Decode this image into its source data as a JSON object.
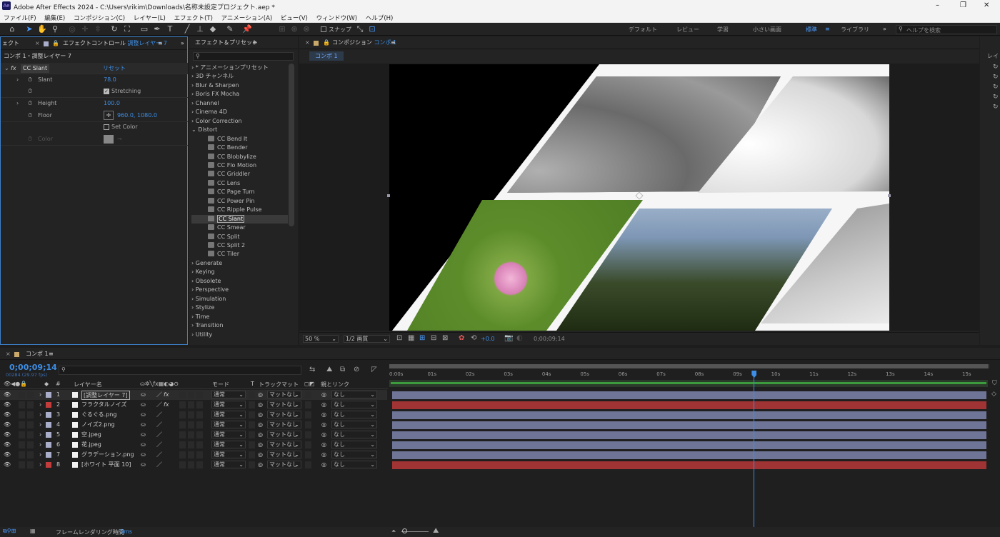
{
  "window": {
    "title": "Adobe After Effects 2024 - C:\\Users\\rikim\\Downloads\\名称未設定プロジェクト.aep *",
    "app_badge": "Ae",
    "controls": [
      "–",
      "❐",
      "✕"
    ]
  },
  "menu": [
    "ファイル(F)",
    "編集(E)",
    "コンポジション(C)",
    "レイヤー(L)",
    "エフェクト(T)",
    "アニメーション(A)",
    "ビュー(V)",
    "ウィンドウ(W)",
    "ヘルプ(H)"
  ],
  "toolbar": {
    "snap_label": "スナップ",
    "workspaces": [
      "デフォルト",
      "レビュー",
      "学習",
      "小さい画面",
      "標準",
      "ライブラリ"
    ],
    "active_workspace": "標準",
    "search_placeholder": "ヘルプを検索",
    "more": "»"
  },
  "effect_controls": {
    "tab_left": "ェクト",
    "tab_prefix": "エフェクトコントロール",
    "tab_layer": "調整レイヤー 7",
    "breadcrumb": "コンポ 1・調整レイヤー 7",
    "effect_name": "CC Slant",
    "reset_label": "リセット",
    "params": [
      {
        "name": "Slant",
        "value": "78.0"
      },
      {
        "name": "",
        "value": "Stretching",
        "type": "checkbox",
        "checked": true
      },
      {
        "name": "Height",
        "value": "100.0"
      },
      {
        "name": "Floor",
        "value": "960.0, 1080.0"
      },
      {
        "name": "",
        "value": "Set Color",
        "type": "checkbox",
        "checked": false
      },
      {
        "name": "Color",
        "value": "",
        "disabled": true
      }
    ]
  },
  "effects_presets": {
    "tab": "エフェクト＆プリセット",
    "search_placeholder": "",
    "items": [
      {
        "label": "* アニメーションプリセット",
        "level": 0
      },
      {
        "label": "3D チャンネル",
        "level": 0
      },
      {
        "label": "Blur & Sharpen",
        "level": 0
      },
      {
        "label": "Boris FX Mocha",
        "level": 0
      },
      {
        "label": "Channel",
        "level": 0
      },
      {
        "label": "Cinema 4D",
        "level": 0
      },
      {
        "label": "Color Correction",
        "level": 0
      },
      {
        "label": "Distort",
        "level": 0,
        "open": true
      },
      {
        "label": "CC Bend It",
        "level": 1
      },
      {
        "label": "CC Bender",
        "level": 1
      },
      {
        "label": "CC Blobbylize",
        "level": 1
      },
      {
        "label": "CC Flo Motion",
        "level": 1
      },
      {
        "label": "CC Griddler",
        "level": 1
      },
      {
        "label": "CC Lens",
        "level": 1
      },
      {
        "label": "CC Page Turn",
        "level": 1
      },
      {
        "label": "CC Power Pin",
        "level": 1
      },
      {
        "label": "CC Ripple Pulse",
        "level": 1
      },
      {
        "label": "CC Slant",
        "level": 1,
        "selected": true
      },
      {
        "label": "CC Smear",
        "level": 1
      },
      {
        "label": "CC Split",
        "level": 1
      },
      {
        "label": "CC Split 2",
        "level": 1
      },
      {
        "label": "CC Tiler",
        "level": 1
      },
      {
        "label": "Generate",
        "level": 0
      },
      {
        "label": "Keying",
        "level": 0
      },
      {
        "label": "Obsolete",
        "level": 0
      },
      {
        "label": "Perspective",
        "level": 0
      },
      {
        "label": "Simulation",
        "level": 0
      },
      {
        "label": "Stylize",
        "level": 0
      },
      {
        "label": "Time",
        "level": 0
      },
      {
        "label": "Transition",
        "level": 0
      },
      {
        "label": "Utility",
        "level": 0
      }
    ]
  },
  "composition": {
    "tab_prefix": "コンポジション",
    "tab_name": "コンポ 1",
    "sub_tab": "コンポ 1",
    "zoom": "50 %",
    "resolution": "1/2 画質",
    "exposure": "+0.0",
    "timecode": "0;00;09;14",
    "right_label": "レイ"
  },
  "timeline": {
    "tab": "コンポ 1",
    "timecode": "0;00;09;14",
    "frames": "00284 (29.97 fps)",
    "headers": {
      "name": "レイヤー名",
      "mode": "モード",
      "t": "T",
      "track_matte": "トラックマット",
      "parent": "親とリンク",
      "num": "#"
    },
    "layers": [
      {
        "num": "1",
        "name": "[調整レイヤー 7]",
        "color": "#a8aec9",
        "mode": "通常",
        "matte": "マットなし",
        "parent": "なし",
        "fx": true,
        "selected": true
      },
      {
        "num": "2",
        "name": "フラクタルノイズ",
        "color": "#c23c3c",
        "mode": "通常",
        "matte": "マットなし",
        "parent": "なし",
        "fx": true
      },
      {
        "num": "3",
        "name": "ぐるぐる.png",
        "color": "#a8aec9",
        "mode": "通常",
        "matte": "マットなし",
        "parent": "なし",
        "fx": false
      },
      {
        "num": "4",
        "name": "ノイズ2.png",
        "color": "#a8aec9",
        "mode": "通常",
        "matte": "マットなし",
        "parent": "なし",
        "fx": false
      },
      {
        "num": "5",
        "name": "空.jpeg",
        "color": "#a8aec9",
        "mode": "通常",
        "matte": "マットなし",
        "parent": "なし",
        "fx": false
      },
      {
        "num": "6",
        "name": "花.jpeg",
        "color": "#a8aec9",
        "mode": "通常",
        "matte": "マットなし",
        "parent": "なし",
        "fx": false
      },
      {
        "num": "7",
        "name": "グラデーション.png",
        "color": "#a8aec9",
        "mode": "通常",
        "matte": "マットなし",
        "parent": "なし",
        "fx": false
      },
      {
        "num": "8",
        "name": "[ホワイト 平面 10]",
        "color": "#c23c3c",
        "mode": "通常",
        "matte": "マットなし",
        "parent": "なし",
        "fx": false
      }
    ],
    "ruler": [
      "0:00s",
      "01s",
      "02s",
      "03s",
      "04s",
      "05s",
      "06s",
      "07s",
      "08s",
      "09s",
      "10s",
      "11s",
      "12s",
      "13s",
      "14s",
      "15s"
    ],
    "bar_colors": [
      "#6f7596",
      "#a03333",
      "#6f7596",
      "#6f7596",
      "#6f7596",
      "#6f7596",
      "#6f7596",
      "#a03333"
    ],
    "playhead_seconds": 9.47,
    "duration_seconds": 15.5,
    "footer_label": "フレームレンダリング時間",
    "footer_value": "5ms"
  }
}
